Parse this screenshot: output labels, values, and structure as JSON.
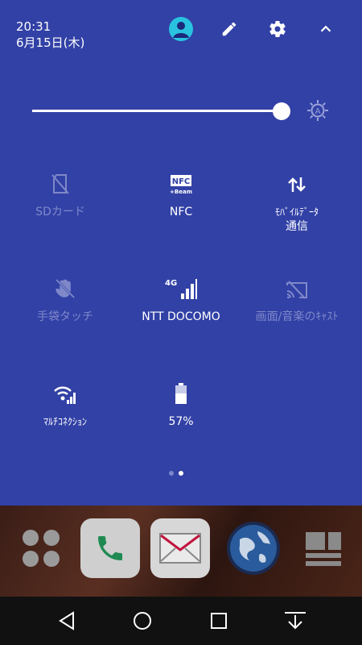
{
  "status": {
    "time": "20:31",
    "date": "6月15日(木)"
  },
  "brightness": {
    "level": 0.95
  },
  "tiles": [
    {
      "label": "SDカード",
      "icon": "sd-card-off-icon",
      "enabled": false
    },
    {
      "label": "NFC",
      "icon": "nfc-beam-icon",
      "enabled": true
    },
    {
      "label1": "ﾓﾊﾞｲﾙﾃﾞｰﾀ",
      "label2": "通信",
      "icon": "mobile-data-icon",
      "enabled": true
    },
    {
      "label": "手袋タッチ",
      "icon": "glove-touch-off-icon",
      "enabled": false
    },
    {
      "label": "NTT DOCOMO",
      "icon": "signal-4g-icon",
      "enabled": true
    },
    {
      "label": "画面/音楽のｷｬｽﾄ",
      "icon": "cast-off-icon",
      "enabled": false
    },
    {
      "label": "ﾏﾙﾁｺﾈｸｼｮﾝ",
      "icon": "multi-connection-icon",
      "enabled": true
    },
    {
      "label": "57%",
      "icon": "battery-icon",
      "enabled": true
    }
  ],
  "battery": {
    "percent": 57
  },
  "pages": {
    "count": 2,
    "current": 2
  },
  "colors": {
    "panel": "#3241a6",
    "avatar": "#29c3e0",
    "dim": "#7f88c9"
  }
}
